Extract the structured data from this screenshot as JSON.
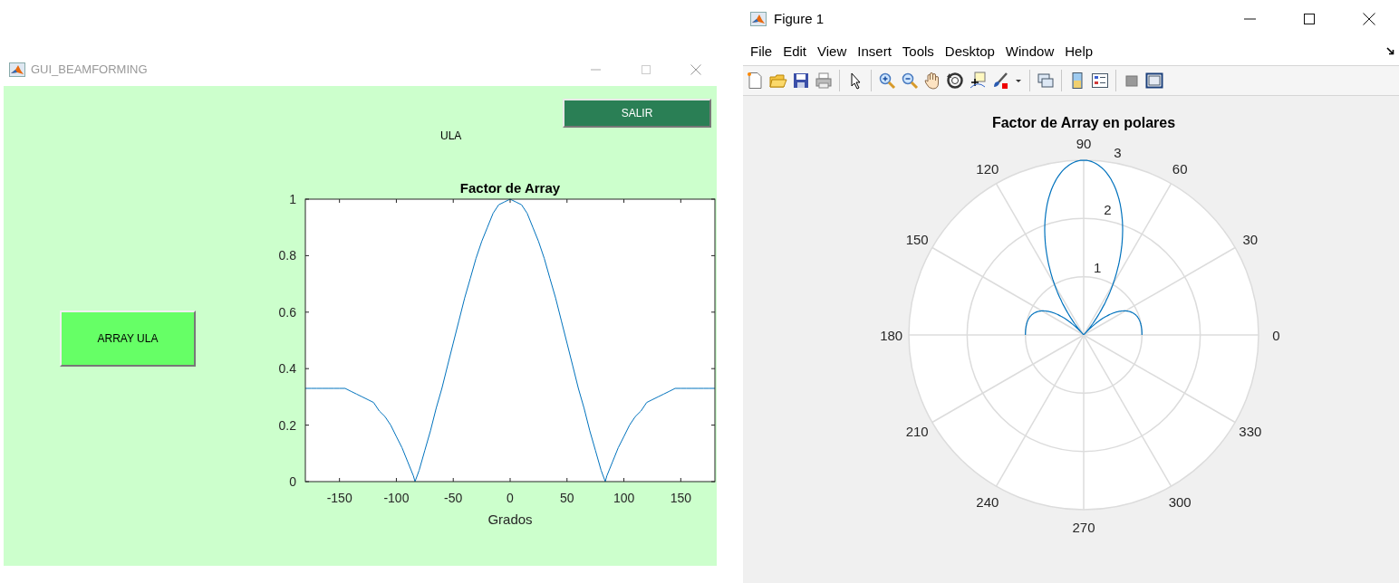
{
  "left_window": {
    "title": "GUI_BEAMFORMING",
    "exit_button": {
      "label": "SALIR"
    },
    "caption": "ULA",
    "array_button": {
      "label": "ARRAY ULA"
    },
    "chart_data": {
      "type": "line",
      "title": "Factor de Array",
      "xlabel": "Grados",
      "xlim": [
        -180,
        180
      ],
      "ylim": [
        0,
        1
      ],
      "x": [
        -180,
        -175,
        -170,
        -165,
        -160,
        -155,
        -150,
        -145,
        -140,
        -135,
        -130,
        -125,
        -120,
        -115,
        -110,
        -105,
        -100,
        -95,
        -90,
        -85,
        -83.6,
        -80,
        -75,
        -70,
        -65,
        -60,
        -55,
        -50,
        -45,
        -40,
        -35,
        -30,
        -25,
        -20,
        -15,
        -10,
        -5,
        0,
        5,
        10,
        15,
        20,
        25,
        30,
        35,
        40,
        45,
        50,
        55,
        60,
        65,
        70,
        75,
        80,
        83.6,
        85,
        90,
        95,
        100,
        105,
        110,
        115,
        120,
        125,
        130,
        135,
        140,
        145,
        150,
        155,
        160,
        165,
        170,
        175,
        180
      ],
      "values": [
        0.33,
        0.33,
        0.33,
        0.33,
        0.33,
        0.33,
        0.33,
        0.33,
        0.32,
        0.31,
        0.3,
        0.29,
        0.28,
        0.25,
        0.23,
        0.2,
        0.16,
        0.12,
        0.07,
        0.02,
        0,
        0.04,
        0.11,
        0.18,
        0.26,
        0.33,
        0.41,
        0.49,
        0.57,
        0.65,
        0.72,
        0.79,
        0.85,
        0.9,
        0.95,
        0.98,
        0.99,
        1,
        0.99,
        0.98,
        0.95,
        0.9,
        0.85,
        0.79,
        0.72,
        0.65,
        0.57,
        0.49,
        0.41,
        0.33,
        0.26,
        0.18,
        0.11,
        0.04,
        0,
        0.02,
        0.07,
        0.12,
        0.16,
        0.2,
        0.23,
        0.25,
        0.28,
        0.29,
        0.3,
        0.31,
        0.32,
        0.33,
        0.33,
        0.33,
        0.33,
        0.33,
        0.33,
        0.33,
        0.33
      ],
      "xticks": [
        -150,
        -100,
        -50,
        0,
        50,
        100,
        150
      ],
      "yticks": [
        0,
        0.2,
        0.4,
        0.6,
        0.8,
        1
      ]
    }
  },
  "right_window": {
    "title": "Figure 1",
    "menu": [
      "File",
      "Edit",
      "View",
      "Insert",
      "Tools",
      "Desktop",
      "Window",
      "Help"
    ],
    "polar_plot": {
      "title": "Factor de Array en polares",
      "angle_labels": [
        "0",
        "30",
        "60",
        "90",
        "120",
        "150",
        "180",
        "210",
        "240",
        "270",
        "300",
        "330"
      ],
      "radius_labels": [
        "1",
        "2",
        "3"
      ]
    }
  }
}
